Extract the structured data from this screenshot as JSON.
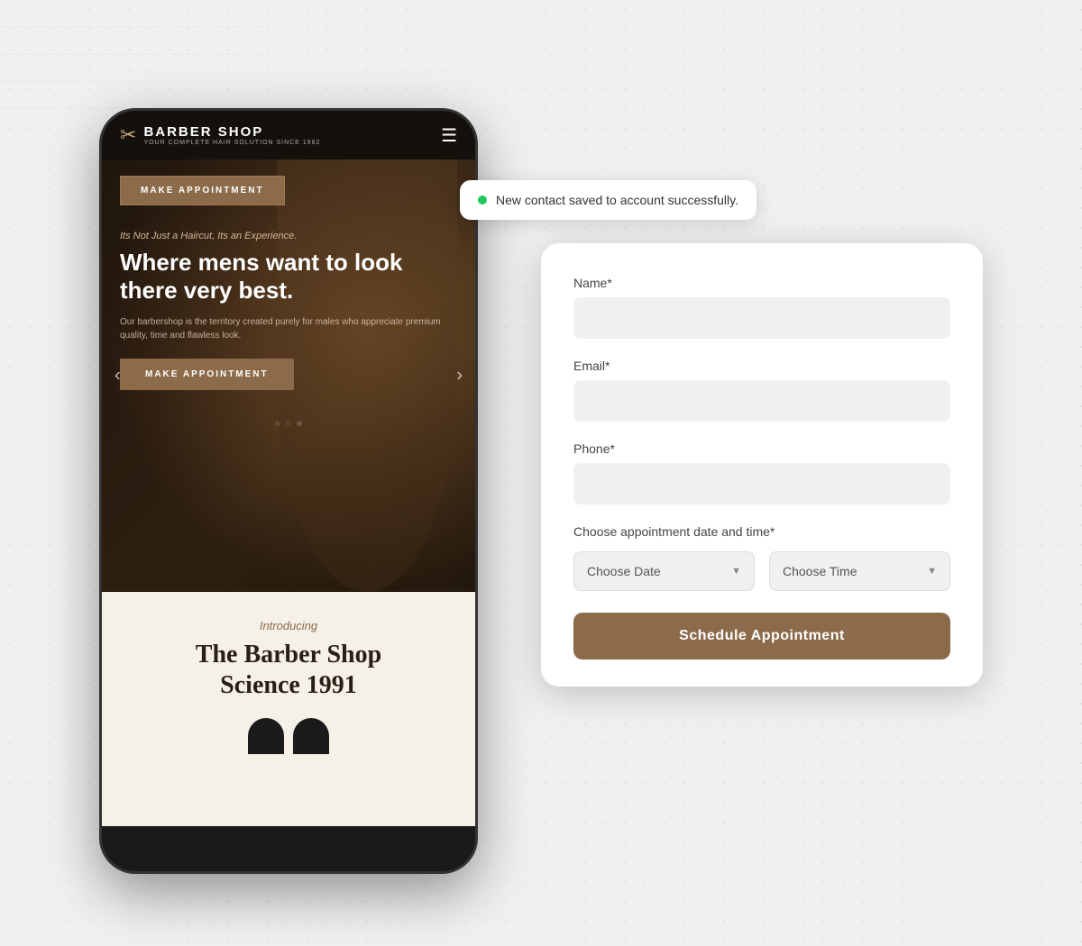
{
  "background": {
    "color": "#e8e8e8"
  },
  "toast": {
    "message": "New contact saved to account successfully.",
    "dot_color": "#22c55e"
  },
  "phone": {
    "brand": "BARBER SHOP",
    "tagline": "YOUR COMPLETE HAIR SOLUTION SINCE 1982",
    "make_appointment_top": "MAKE APPOINTMENT",
    "hero_tagline": "Its Not Just a Haircut, Its an Experience.",
    "hero_heading": "Where mens want to look there very best.",
    "hero_desc": "Our barbershop is the territory created purely for males who appreciate premium quality, time and flawless look.",
    "make_appointment_bottom": "MAKE APPOINTMENT",
    "intro_label": "Introducing",
    "intro_title_line1": "The Barber Shop",
    "intro_title_line2": "Science 1991"
  },
  "form": {
    "name_label": "Name*",
    "name_placeholder": "",
    "email_label": "Email*",
    "email_placeholder": "",
    "phone_label": "Phone*",
    "phone_placeholder": "",
    "datetime_label": "Choose appointment date and time*",
    "choose_date_label": "Choose Date",
    "choose_time_label": "Choose Time",
    "submit_label": "Schedule Appointment"
  }
}
